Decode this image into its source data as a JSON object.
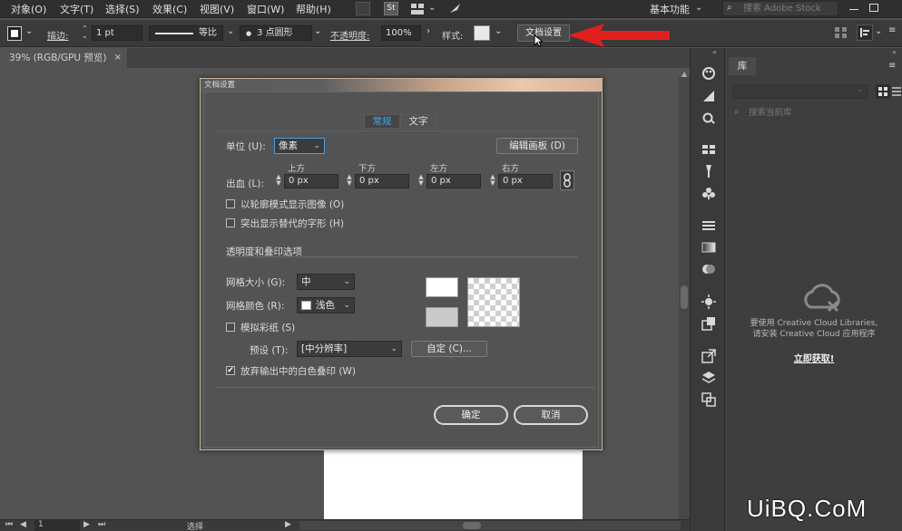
{
  "menubar": {
    "items": [
      "对象(O)",
      "文字(T)",
      "选择(S)",
      "效果(C)",
      "视图(V)",
      "窗口(W)",
      "帮助(H)"
    ],
    "workspace": "基本功能",
    "search_placeholder": "搜索 Adobe Stock",
    "st_badge": "St"
  },
  "controlbar": {
    "stroke_label": "描边:",
    "stroke_value": "1 pt",
    "profile_label": "等比",
    "brush_label": "3 点圆形",
    "opacity_label": "不透明度:",
    "opacity_value": "100%",
    "style_label": "样式:",
    "doc_setup_button": "文档设置"
  },
  "tab": {
    "title": "39% (RGB/GPU 预览)"
  },
  "statusbar": {
    "page": "1",
    "tool": "选择"
  },
  "dialog": {
    "title": "文档设置",
    "tabs": [
      "常规",
      "文字"
    ],
    "active_tab": "常规",
    "units_label": "单位 (U):",
    "units_value": "像素",
    "edit_artboards_button": "编辑画板 (D)",
    "bleed_label": "出血 (L):",
    "bleed_headers": [
      "上方",
      "下方",
      "左方",
      "右方"
    ],
    "bleed_values": [
      "0 px",
      "0 px",
      "0 px",
      "0 px"
    ],
    "outline_mode_label": "以轮廓模式显示图像 (O)",
    "highlight_glyphs_label": "突出显示替代的字形 (H)",
    "transparency_section": "透明度和叠印选项",
    "grid_size_label": "网格大小 (G):",
    "grid_size_value": "中",
    "grid_color_label": "网格颜色 (R):",
    "grid_color_value": "浅色",
    "simulate_paper_label": "模拟彩纸 (S)",
    "preset_label": "预设 (T):",
    "preset_value": "[中分辨率]",
    "custom_button": "自定 (C)...",
    "discard_overprint_label": "放弃输出中的白色叠印 (W)",
    "discard_overprint_checked": true,
    "ok_button": "确定",
    "cancel_button": "取消"
  },
  "library": {
    "tab": "库",
    "search_placeholder": "搜索当前库",
    "message_line1": "要使用 Creative Cloud Libraries,",
    "message_line2": "请安装 Creative Cloud 应用程序",
    "link": "立即获取!"
  },
  "watermark": "UiBQ.CoM",
  "colors": {
    "arrow": "#e0201c",
    "accent": "#4a9fe0"
  }
}
